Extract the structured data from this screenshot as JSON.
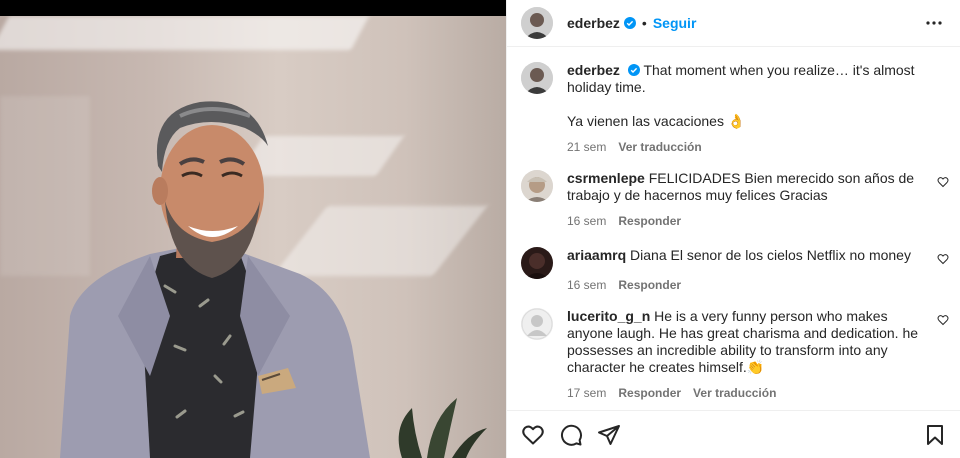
{
  "post": {
    "author": "ederbez",
    "follow_label": "Seguir",
    "dot": "•"
  },
  "caption": {
    "username": "ederbez",
    "text": "That moment when you realize… it's almost holiday time.",
    "text2": "Ya vienen las vacaciones 👌",
    "time": "21 sem",
    "translate": "Ver traducción"
  },
  "comments": [
    {
      "username": "csrmenlepe",
      "text": "FELICIDADES Bien merecido son años de trabajo y de hacernos muy felices Gracias",
      "time": "16 sem",
      "reply": "Responder"
    },
    {
      "username": "ariaamrq",
      "text": "Diana El senor de los cielos Netflix no money",
      "time": "16 sem",
      "reply": "Responder"
    },
    {
      "username": "lucerito_g_n",
      "text": "He is a very funny person who makes anyone laugh. He has great charisma and dedication. he possesses an incredible ability to transform into any character he creates himself.👏",
      "time": "17 sem",
      "reply": "Responder",
      "translate": "Ver traducción"
    }
  ],
  "icons": [
    "verified-icon",
    "more-options-icon",
    "heart-icon",
    "comment-icon",
    "share-icon",
    "save-icon"
  ],
  "colors": {
    "accent": "#0095f6",
    "verified": "#0095f6",
    "muted": "#737373"
  }
}
